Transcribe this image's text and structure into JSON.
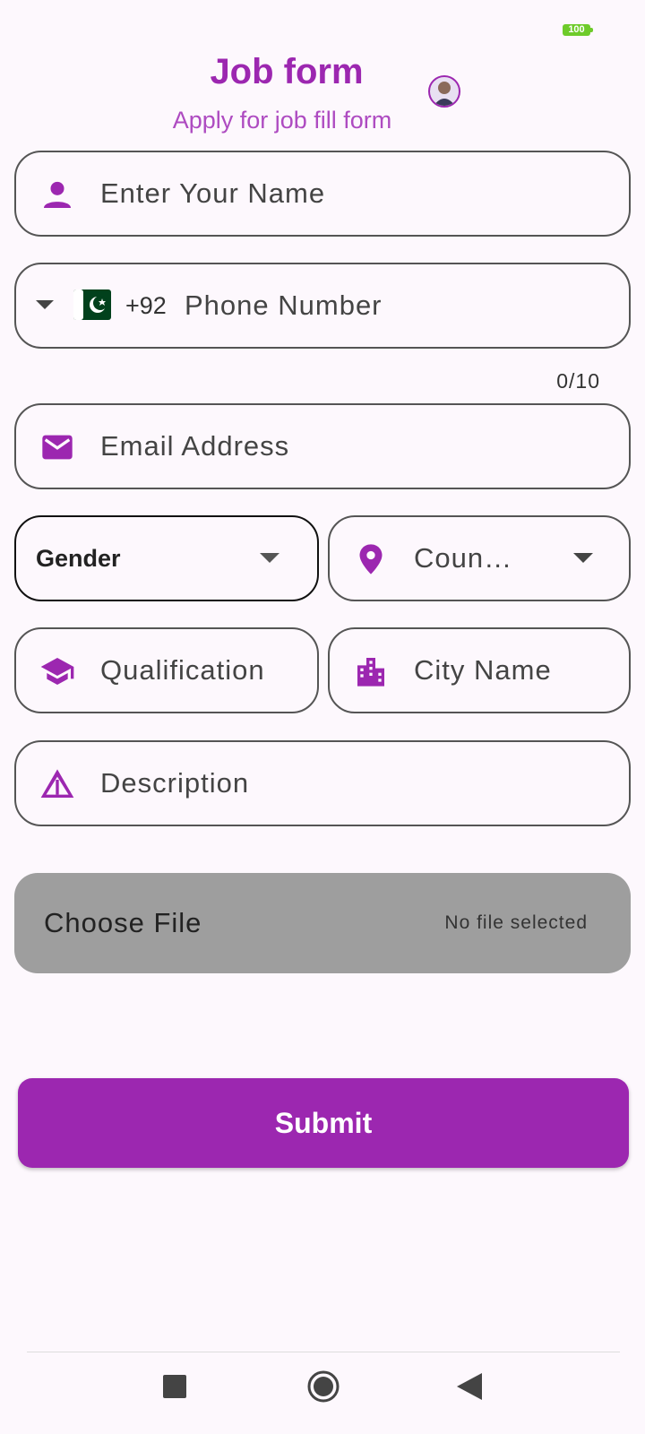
{
  "status_bar": {
    "battery_level": "100"
  },
  "header": {
    "title": "Job form",
    "subtitle": "Apply for job fill form",
    "avatar_icon": "profile-avatar"
  },
  "form": {
    "name": {
      "placeholder": "Enter Your Name",
      "icon": "person-icon"
    },
    "phone": {
      "country_flag": "pakistan-flag",
      "dial_code": "+92",
      "placeholder": "Phone Number",
      "counter": "0/10"
    },
    "email": {
      "placeholder": "Email Address",
      "icon": "mail-icon"
    },
    "gender": {
      "label": "Gender"
    },
    "country": {
      "label": "Coun…",
      "icon": "location-pin-icon"
    },
    "qualification": {
      "placeholder": "Qualification",
      "icon": "school-icon"
    },
    "city": {
      "placeholder": "City Name",
      "icon": "city-icon"
    },
    "description": {
      "placeholder": "Description",
      "icon": "warning-triangle-icon"
    },
    "file": {
      "button_label": "Choose File",
      "status": "No file selected"
    },
    "submit_label": "Submit"
  },
  "colors": {
    "accent": "#9c27b0",
    "file_bg": "#9e9e9e",
    "background": "#fdf8fd",
    "battery": "#6ecb2a"
  }
}
